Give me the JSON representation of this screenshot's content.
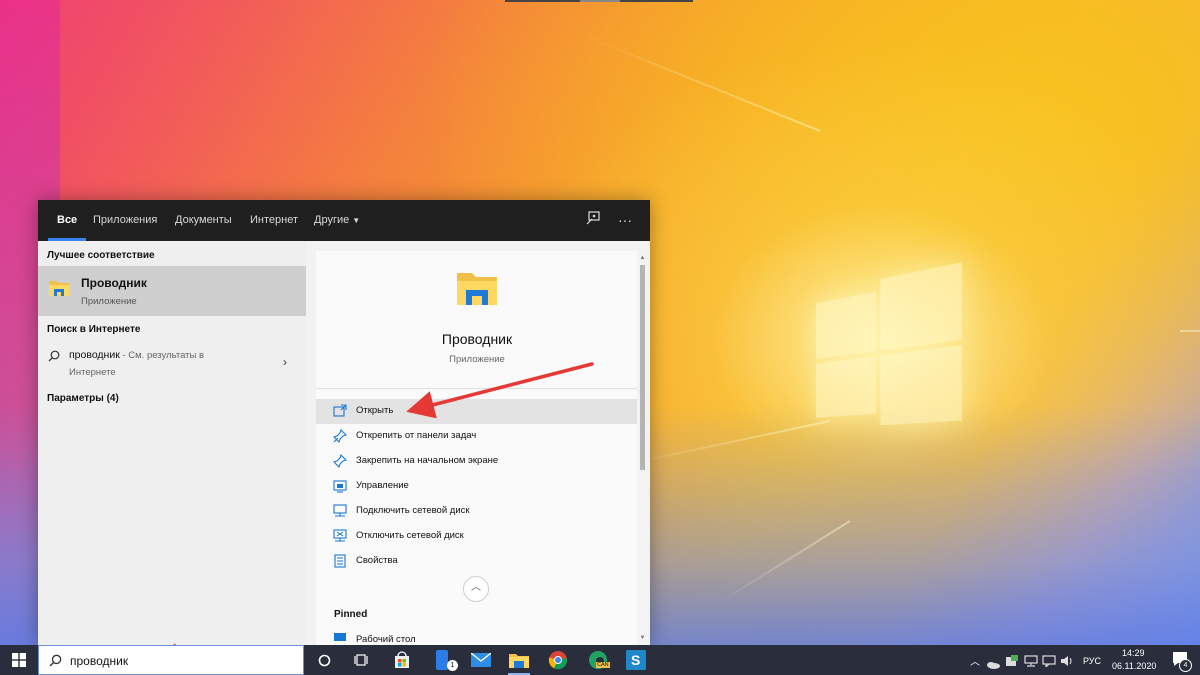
{
  "desktop": {
    "accent": "#3b82f6"
  },
  "search_panel": {
    "tabs": [
      {
        "label": "Все",
        "active": true
      },
      {
        "label": "Приложения"
      },
      {
        "label": "Документы"
      },
      {
        "label": "Интернет"
      },
      {
        "label": "Другие"
      }
    ],
    "header_icons": [
      "feedback-icon",
      "more-icon"
    ],
    "more_glyph": "···",
    "best_match": {
      "section_title": "Лучшее соответствие",
      "name": "Проводник",
      "type": "Приложение",
      "icon": "file-explorer-icon"
    },
    "web_search": {
      "section_title": "Поиск в Интернете",
      "query": "проводник",
      "suffix_line1": " - См. результаты в",
      "suffix_line2": "Интернете"
    },
    "settings_section": {
      "title": "Параметры (4)"
    },
    "details": {
      "app_name": "Проводник",
      "app_type": "Приложение",
      "actions": [
        {
          "label": "Открыть",
          "icon": "open-icon",
          "highlighted": true
        },
        {
          "label": "Открепить от панели задач",
          "icon": "unpin-taskbar-icon"
        },
        {
          "label": "Закрепить на начальном экране",
          "icon": "pin-start-icon"
        },
        {
          "label": "Управление",
          "icon": "manage-icon"
        },
        {
          "label": "Подключить сетевой диск",
          "icon": "map-drive-icon"
        },
        {
          "label": "Отключить сетевой диск",
          "icon": "disconnect-drive-icon"
        },
        {
          "label": "Свойства",
          "icon": "properties-icon"
        }
      ],
      "pinned_title": "Pinned",
      "pinned_items": [
        {
          "label": "Рабочий стол",
          "icon": "desktop-icon"
        }
      ]
    }
  },
  "taskbar": {
    "search_query": "проводник",
    "apps": [
      {
        "name": "cortana-icon"
      },
      {
        "name": "task-view-icon"
      },
      {
        "name": "store-icon"
      },
      {
        "name": "phone-icon",
        "badge": "1"
      },
      {
        "name": "mail-icon"
      },
      {
        "name": "file-explorer-icon"
      },
      {
        "name": "chrome-icon"
      },
      {
        "name": "edge-canary-icon",
        "badge_text": "CAN"
      },
      {
        "name": "snagit-icon"
      }
    ],
    "tray": {
      "language": "РУС",
      "time": "14:29",
      "date": "06.11.2020",
      "notifications": "4"
    }
  }
}
